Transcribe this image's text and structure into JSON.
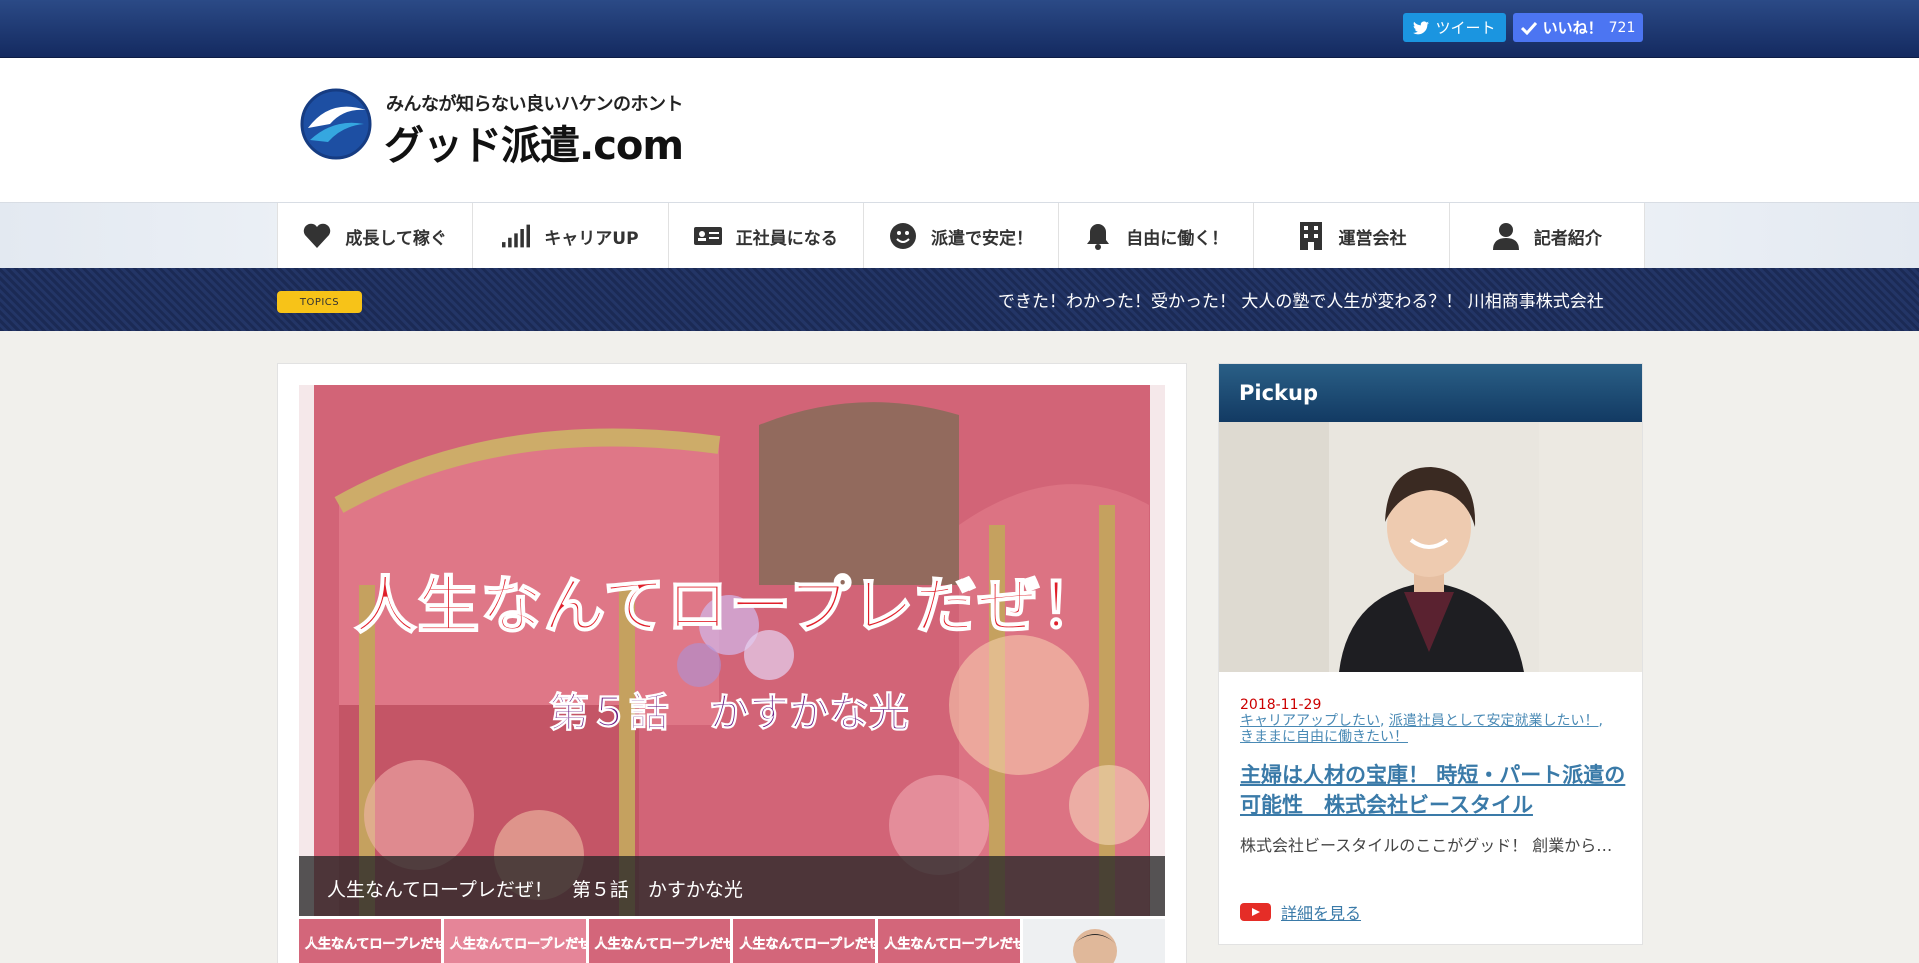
{
  "topbar": {
    "tweet_label": "ツイート",
    "like_label": "いいね！",
    "like_count": "721"
  },
  "header": {
    "logo_tagline": "みんなが知らない良いハケンのホント",
    "logo_name": "グッド派遣.com"
  },
  "nav": {
    "items": [
      {
        "label": "成長して稼ぐ",
        "icon": "heart-icon"
      },
      {
        "label": "キャリアUP",
        "icon": "signal-bars-icon"
      },
      {
        "label": "正社員になる",
        "icon": "id-card-icon"
      },
      {
        "label": "派遣で安定！",
        "icon": "smile-icon"
      },
      {
        "label": "自由に働く！",
        "icon": "bell-icon"
      },
      {
        "label": "運営会社",
        "icon": "building-icon"
      },
      {
        "label": "記者紹介",
        "icon": "user-icon"
      }
    ]
  },
  "topics": {
    "badge": "TOPICS",
    "text": "できた！わかった！受かった！ 大人の塾で人生が変わる？！ 川相商事株式会社"
  },
  "slider": {
    "headline": "人生なんてロープレだぜ！",
    "subheadline": "第５話　かすかな光",
    "caption": "人生なんてロープレだぜ！　第５話　かすかな光",
    "thumb_text": "人生なんてロープレだぜ！"
  },
  "sidebar": {
    "title": "Pickup",
    "date": "2018-11-29",
    "categories": [
      "キャリアアップしたい",
      "派遣社員として安定就業したい！",
      "きままに自由に働きたい！"
    ],
    "article_title": "主婦は人材の宝庫！ 時短・パート派遣の可能性　株式会社ビースタイル",
    "excerpt": "株式会社ビースタイルのここがグッド！ 創業から…",
    "more_label": "詳細を見る"
  },
  "colors": {
    "topbar": "#1c3670",
    "topics_badge": "#f7c318",
    "pickup_header": "#1a4a73",
    "date": "#cc0000",
    "link": "#3a7aa8"
  }
}
